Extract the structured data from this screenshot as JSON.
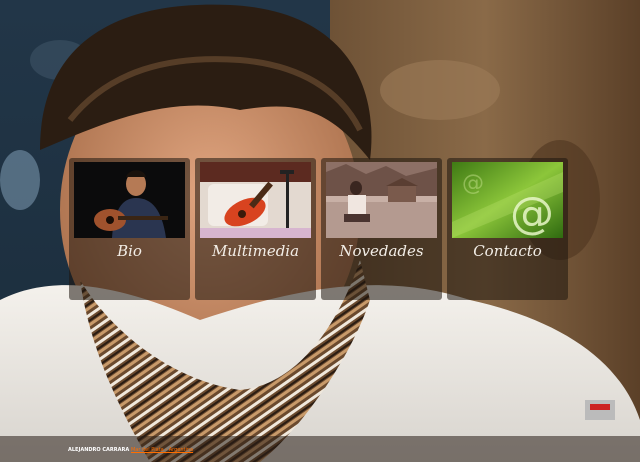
{
  "nav": {
    "items": [
      {
        "label": "Bio",
        "icon": "guitarist-photo"
      },
      {
        "label": "Multimedia",
        "icon": "guitar-photo"
      },
      {
        "label": "Novedades",
        "icon": "news-photo"
      },
      {
        "label": "Contacto",
        "icon": "at-sign-icon"
      }
    ]
  },
  "footer": {
    "name": "ALEJANDRO CARRARA",
    "location_link": "Mar del Plata - Argentina"
  },
  "colors": {
    "card_bg": "#1e160f",
    "label_text": "#f2ede6",
    "footer_link": "#ff6e00",
    "contact_green": "#6fae2a"
  }
}
